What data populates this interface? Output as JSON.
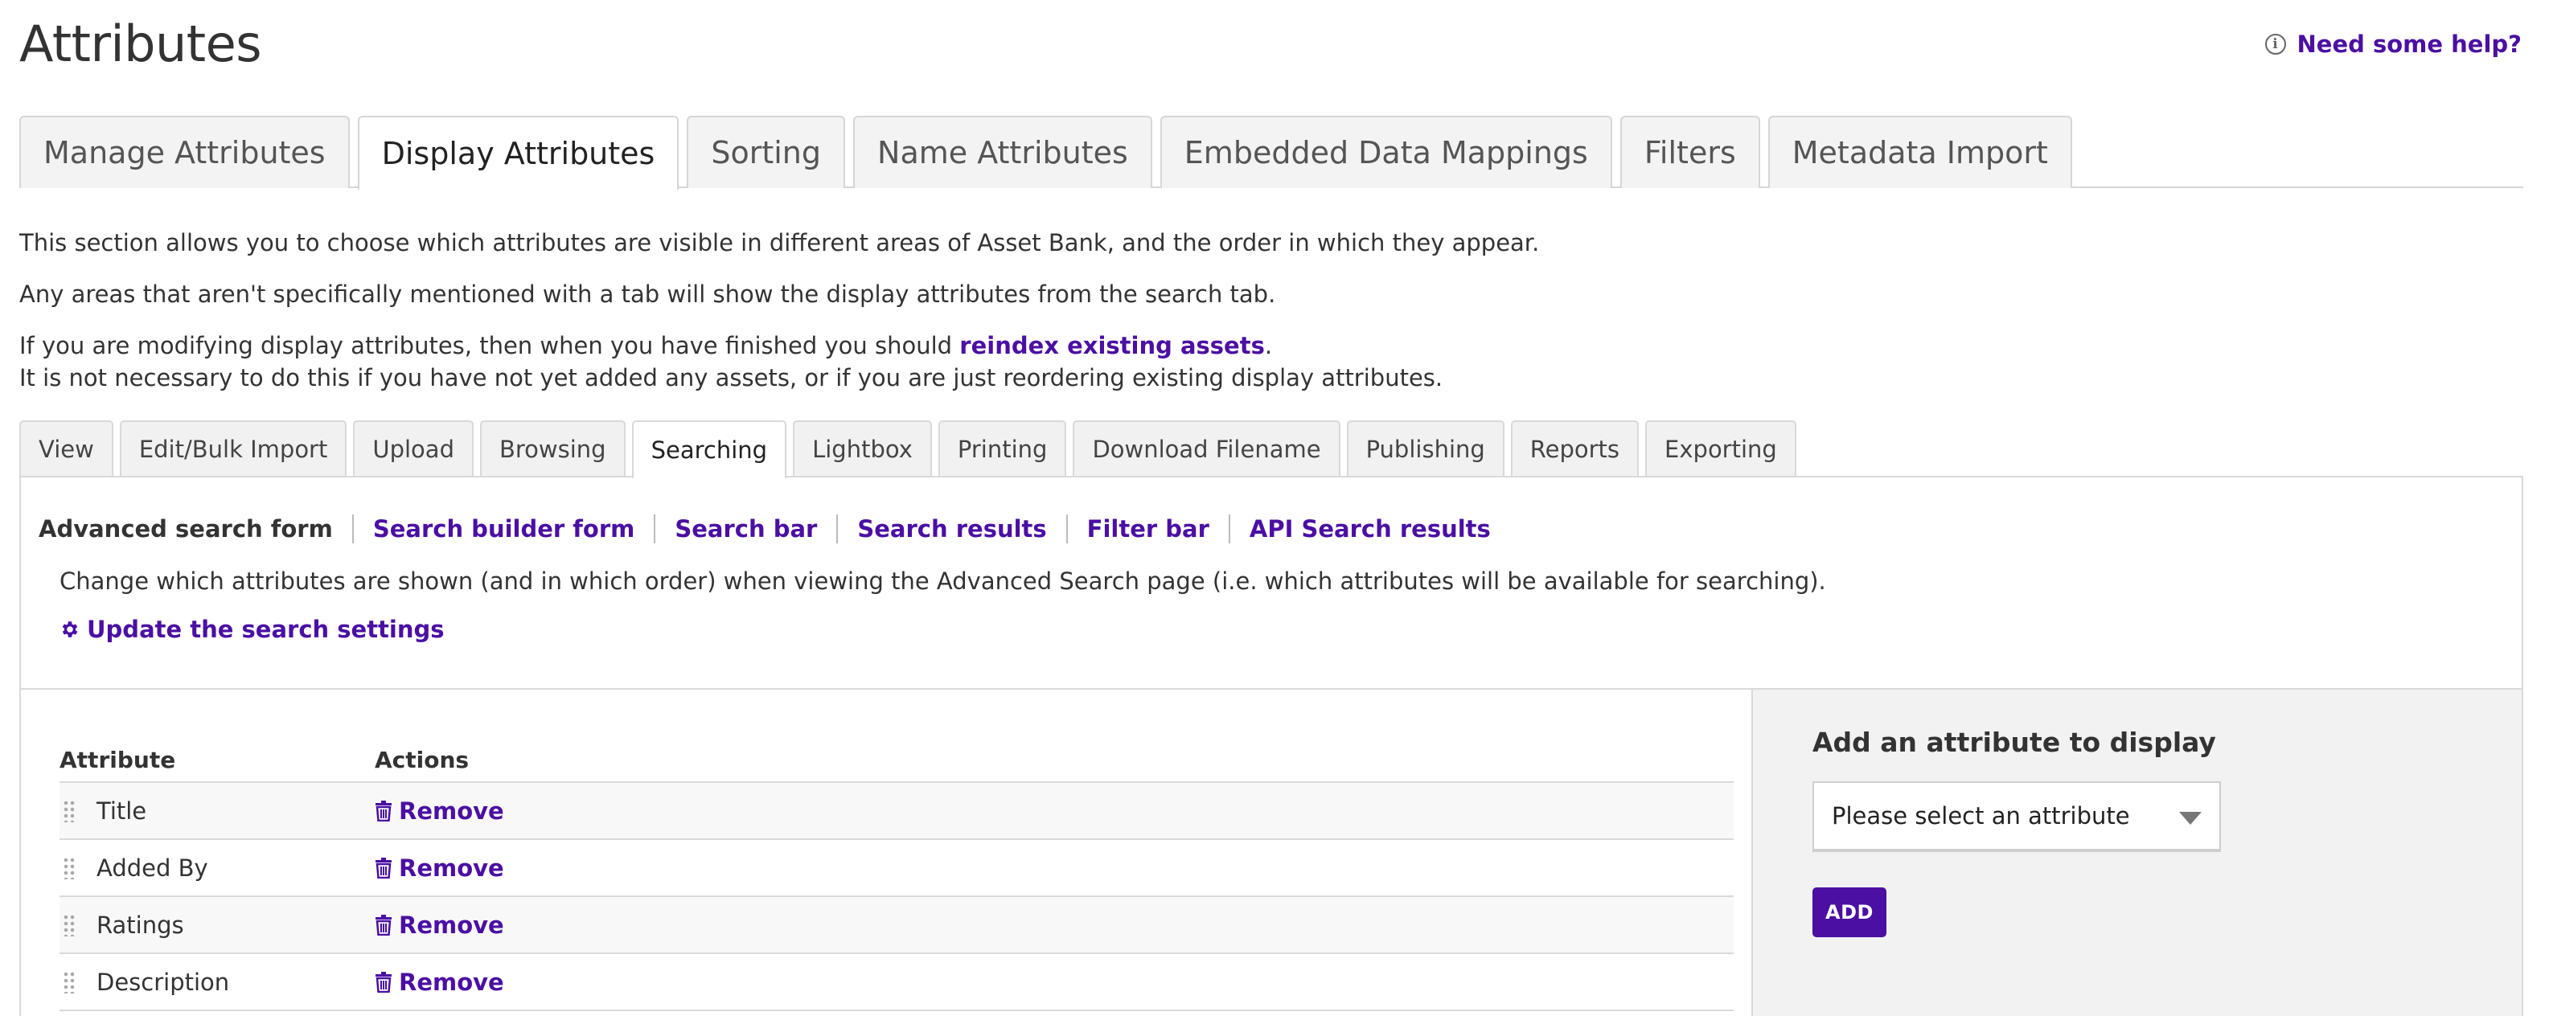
{
  "page": {
    "title": "Attributes",
    "help_label": "Need some help?"
  },
  "main_tabs": [
    {
      "label": "Manage Attributes",
      "active": false
    },
    {
      "label": "Display Attributes",
      "active": true
    },
    {
      "label": "Sorting",
      "active": false
    },
    {
      "label": "Name Attributes",
      "active": false
    },
    {
      "label": "Embedded Data Mappings",
      "active": false
    },
    {
      "label": "Filters",
      "active": false
    },
    {
      "label": "Metadata Import",
      "active": false
    }
  ],
  "intro": {
    "line1": "This section allows you to choose which attributes are visible in different areas of Asset Bank, and the order in which they appear.",
    "line2": "Any areas that aren't specifically mentioned with a tab will show the display attributes from the search tab.",
    "line3_pre": "If you are modifying display attributes, then when you have finished you should ",
    "line3_link": "reindex existing assets",
    "line3_post": ".",
    "line4": "It is not necessary to do this if you have not yet added any assets, or if you are just reordering existing display attributes."
  },
  "sub_tabs": [
    {
      "label": "View",
      "active": false
    },
    {
      "label": "Edit/Bulk Import",
      "active": false
    },
    {
      "label": "Upload",
      "active": false
    },
    {
      "label": "Browsing",
      "active": false
    },
    {
      "label": "Searching",
      "active": true
    },
    {
      "label": "Lightbox",
      "active": false
    },
    {
      "label": "Printing",
      "active": false
    },
    {
      "label": "Download Filename",
      "active": false
    },
    {
      "label": "Publishing",
      "active": false
    },
    {
      "label": "Reports",
      "active": false
    },
    {
      "label": "Exporting",
      "active": false
    }
  ],
  "search_links": {
    "current": "Advanced search form",
    "links": [
      "Search builder form",
      "Search bar",
      "Search results",
      "Filter bar",
      "API Search results"
    ]
  },
  "description": "Change which attributes are shown (and in which order) when viewing the Advanced Search page (i.e. which attributes will be available for searching).",
  "settings_link": "Update the search settings",
  "table": {
    "headers": {
      "attribute": "Attribute",
      "actions": "Actions"
    },
    "rows": [
      {
        "name": "Title",
        "action": "Remove"
      },
      {
        "name": "Added By",
        "action": "Remove"
      },
      {
        "name": "Ratings",
        "action": "Remove"
      },
      {
        "name": "Description",
        "action": "Remove"
      }
    ]
  },
  "add_panel": {
    "title": "Add an attribute to display",
    "select_value": "Please select an attribute",
    "button_label": "ADD"
  },
  "colors": {
    "accent": "#4b0fa3",
    "panel_bg": "#f2f2f2",
    "border": "#d9d9d9"
  }
}
